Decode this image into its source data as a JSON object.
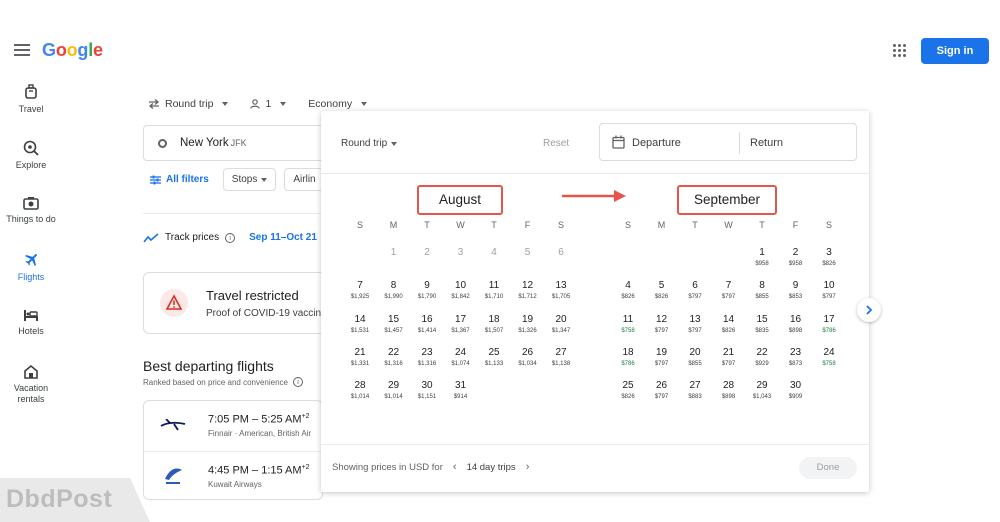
{
  "header": {
    "logo": [
      "G",
      "o",
      "o",
      "g",
      "l",
      "e"
    ],
    "signin_label": "Sign in"
  },
  "nav": [
    {
      "label": "Travel",
      "icon": "suitcase-icon"
    },
    {
      "label": "Explore",
      "icon": "explore-icon"
    },
    {
      "label": "Things to do",
      "icon": "camera-icon"
    },
    {
      "label": "Flights",
      "icon": "airplane-icon",
      "active": true
    },
    {
      "label": "Hotels",
      "icon": "bed-icon"
    },
    {
      "label": "Vacation rentals",
      "icon": "house-icon"
    }
  ],
  "search": {
    "trip_type": "Round trip",
    "passengers": "1",
    "cabin": "Economy",
    "origin_city": "New York",
    "origin_code": "JFK"
  },
  "filters": {
    "all_filters": "All filters",
    "stops": "Stops",
    "airlines": "Airlin"
  },
  "track": {
    "label": "Track prices",
    "dates": "Sep 11–Oct 21"
  },
  "restricted": {
    "title": "Travel restricted",
    "subtitle": "Proof of COVID-19 vaccin"
  },
  "best": {
    "title": "Best departing flights",
    "subtitle": "Ranked based on price and convenience",
    "flights": [
      {
        "time": "7:05 PM – 5:25 AM",
        "plus": "+2",
        "airline": "Finnair · American, British Air"
      },
      {
        "time": "4:45 PM – 1:15 AM",
        "plus": "+2",
        "airline": "Kuwait Airways"
      }
    ]
  },
  "watermark": "DbdPost",
  "calendar": {
    "trip_type": "Round trip",
    "reset": "Reset",
    "departure": "Departure",
    "return": "Return",
    "weekdays": [
      "S",
      "M",
      "T",
      "W",
      "T",
      "F",
      "S"
    ],
    "months": [
      {
        "name": "August",
        "weeks": [
          [
            null,
            [
              "1",
              ""
            ],
            [
              "2",
              ""
            ],
            [
              "3",
              ""
            ],
            [
              "4",
              ""
            ],
            [
              "5",
              ""
            ],
            [
              "6",
              ""
            ]
          ],
          [
            [
              "7",
              "$1,925"
            ],
            [
              "8",
              "$1,990"
            ],
            [
              "9",
              "$1,790"
            ],
            [
              "10",
              "$1,842"
            ],
            [
              "11",
              "$1,710"
            ],
            [
              "12",
              "$1,712"
            ],
            [
              "13",
              "$1,705"
            ]
          ],
          [
            [
              "14",
              "$1,531"
            ],
            [
              "15",
              "$1,457"
            ],
            [
              "16",
              "$1,414"
            ],
            [
              "17",
              "$1,367"
            ],
            [
              "18",
              "$1,507"
            ],
            [
              "19",
              "$1,326"
            ],
            [
              "20",
              "$1,347"
            ]
          ],
          [
            [
              "21",
              "$1,331"
            ],
            [
              "22",
              "$1,316"
            ],
            [
              "23",
              "$1,316"
            ],
            [
              "24",
              "$1,074"
            ],
            [
              "25",
              "$1,133"
            ],
            [
              "26",
              "$1,034"
            ],
            [
              "27",
              "$1,138"
            ]
          ],
          [
            [
              "28",
              "$1,014"
            ],
            [
              "29",
              "$1,014"
            ],
            [
              "30",
              "$1,151"
            ],
            [
              "31",
              "$914"
            ],
            null,
            null,
            null
          ]
        ]
      },
      {
        "name": "September",
        "weeks": [
          [
            null,
            null,
            null,
            null,
            [
              "1",
              "$958"
            ],
            [
              "2",
              "$958"
            ],
            [
              "3",
              "$826"
            ]
          ],
          [
            [
              "4",
              "$826"
            ],
            [
              "5",
              "$826"
            ],
            [
              "6",
              "$797"
            ],
            [
              "7",
              "$797"
            ],
            [
              "8",
              "$855"
            ],
            [
              "9",
              "$853"
            ],
            [
              "10",
              "$797"
            ]
          ],
          [
            [
              "11",
              "$758",
              "low"
            ],
            [
              "12",
              "$797"
            ],
            [
              "13",
              "$797"
            ],
            [
              "14",
              "$826"
            ],
            [
              "15",
              "$835"
            ],
            [
              "16",
              "$898"
            ],
            [
              "17",
              "$786",
              "low"
            ]
          ],
          [
            [
              "18",
              "$786",
              "low"
            ],
            [
              "19",
              "$797"
            ],
            [
              "20",
              "$855"
            ],
            [
              "21",
              "$797"
            ],
            [
              "22",
              "$929"
            ],
            [
              "23",
              "$873"
            ],
            [
              "24",
              "$758",
              "low"
            ]
          ],
          [
            [
              "25",
              "$826"
            ],
            [
              "26",
              "$797"
            ],
            [
              "27",
              "$883"
            ],
            [
              "28",
              "$898"
            ],
            [
              "29",
              "$1,043"
            ],
            [
              "30",
              "$909"
            ],
            null
          ]
        ]
      }
    ],
    "footer_text": "Showing prices in USD for",
    "trip_length": "14 day trips",
    "done": "Done"
  },
  "colors": {
    "accent": "#1a73e8",
    "highlight": "#e5564a",
    "low_price": "#188038"
  }
}
